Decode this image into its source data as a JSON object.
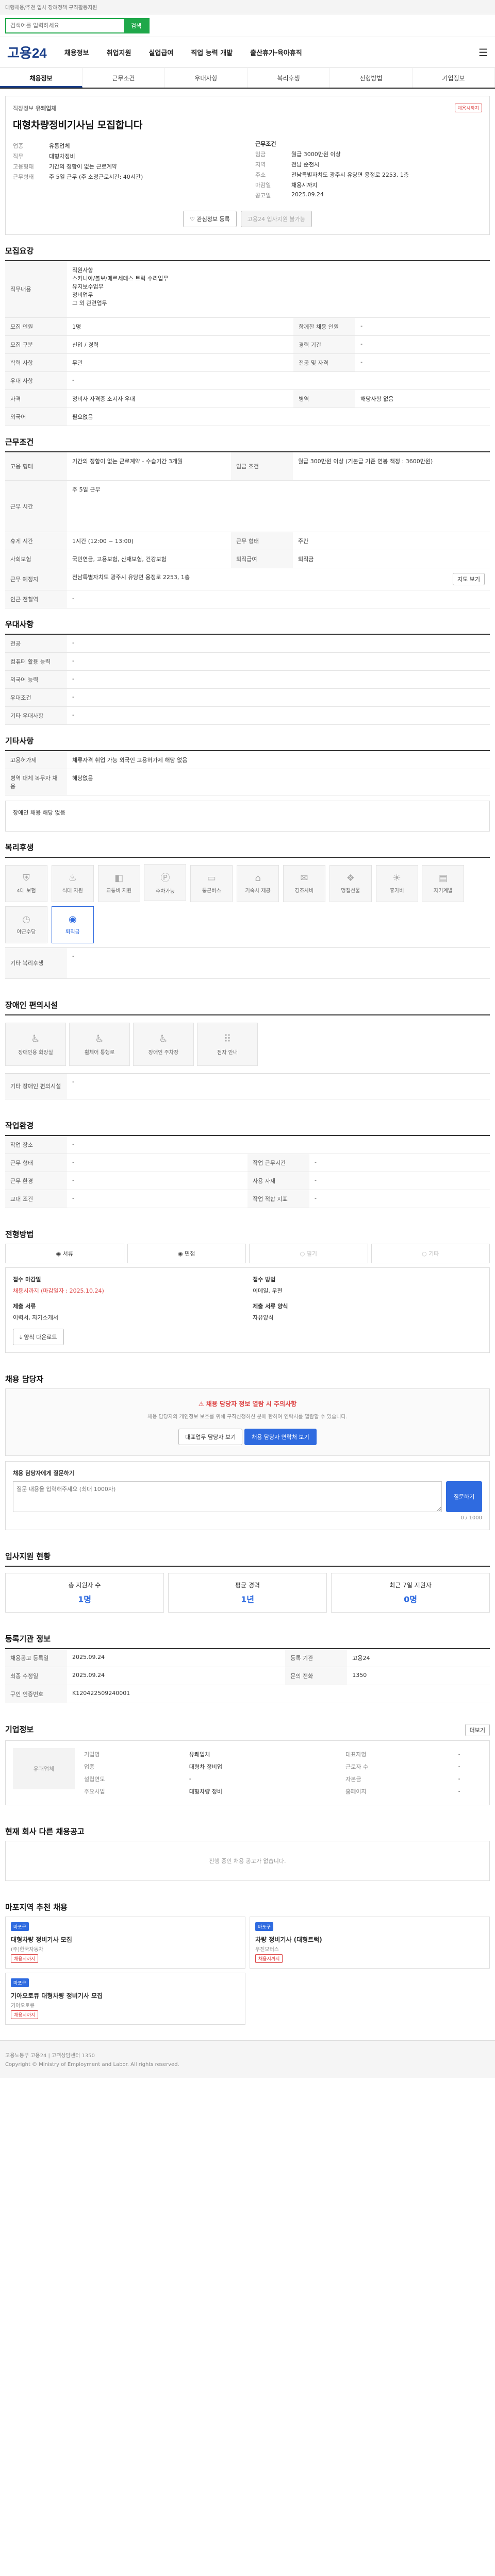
{
  "top_notice": "대행채용/추천 입사 장려정책 구직활동지원",
  "search": {
    "placeholder": "검색어를 입력하세요",
    "button": "검색"
  },
  "gnb": {
    "logo": "고용24",
    "menus": [
      "채용정보",
      "취업지원",
      "실업급여",
      "직업 능력 개발",
      "출산휴가·육아휴직"
    ]
  },
  "tabs": [
    "채용정보",
    "근무조건",
    "우대사항",
    "복리후생",
    "전형방법",
    "기업정보"
  ],
  "job": {
    "company_label": "직장정보",
    "company": "유쾌업체",
    "badge": "채용시까지",
    "title": "대형차량정비기사님 모집합니다",
    "left_rows": [
      [
        "업종",
        "유통업체"
      ],
      [
        "직무",
        "대형차정비"
      ],
      [
        "고용형태",
        "기간의 정함이 없는 근로계약"
      ],
      [
        "근무형태",
        "주 5일 근무 (주 소정근로시간: 40시간)"
      ]
    ],
    "right_label": "근무조건",
    "right_rows": [
      [
        "임금",
        "월급 3000만원 이상"
      ],
      [
        "지역",
        "전남 순천시"
      ],
      [
        "주소",
        "전남특별자치도 광주시 유당면 용정로 2253, 1층"
      ],
      [
        "마감일",
        "채용시까지"
      ],
      [
        "공고일",
        "2025.09.24"
      ]
    ],
    "save_label": "관심정보 등록",
    "apply_label": "고용24 입사지원 불가능"
  },
  "recruit": {
    "title": "모집요강",
    "duty_label": "직무내용",
    "duty": "직원사항\n스카니아/볼보/메르세데스 트럭 수리업무\n유지보수업무\n정비업무\n그 외 관련업무",
    "rows": [
      [
        "모집 인원",
        "1명",
        "함께한 채용 인원",
        "-"
      ],
      [
        "모집 구분",
        "신입 / 경력",
        "경력 기간",
        "-"
      ],
      [
        "학력 사항",
        "무관",
        "전공 및 자격",
        "-"
      ],
      [
        "우대 사항",
        "-",
        "",
        ""
      ],
      [
        "자격",
        "정비사 자격증 소지자 우대",
        "병역",
        "해당사항 없음"
      ],
      [
        "외국어",
        "필요없음",
        "",
        ""
      ]
    ]
  },
  "cond": {
    "title": "근무조건",
    "rows": [
      [
        "고용 형태",
        "기간의 정함이 없는 근로계약 - 수습기간 3개월",
        "임금 조건",
        "월급 300만원 이상 (기본급 기준 연봉 책정 : 3600만원)"
      ],
      [
        "근무 시간",
        "주 5일 근무",
        "",
        ""
      ],
      [
        "휴게 시간",
        "1시간 (12:00 ~ 13:00)",
        "근무 형태",
        "주간"
      ],
      [
        "사회보험",
        "국민연금, 고용보험, 산재보험, 건강보험",
        "퇴직급여",
        "퇴직금"
      ],
      [
        "근무 예정지",
        "전남특별자치도 광주시 유당면 용정로 2253, 1층",
        "",
        ""
      ],
      [
        "인근 전철역",
        "-",
        "",
        ""
      ]
    ],
    "map_button": "지도 보기"
  },
  "pref": {
    "title": "우대사항",
    "rows": [
      [
        "전공",
        "-"
      ],
      [
        "컴퓨터 활용 능력",
        "-"
      ],
      [
        "외국어 능력",
        "-"
      ],
      [
        "우대조건",
        "-"
      ],
      [
        "기타 우대사항",
        "-"
      ]
    ]
  },
  "other": {
    "title": "기타사항",
    "rows": [
      [
        "고용허가제",
        "체류자격 취업 가능 외국인 고용허가제 해당 없음"
      ],
      [
        "병역 대체 복무자 채용",
        "해당없음"
      ]
    ],
    "disabled": "장애인 채용 해당 없음"
  },
  "welfare": {
    "title": "복리후생",
    "items": [
      "4대 보험",
      "식대 지원",
      "교통비 지원",
      "주차가능",
      "통근버스",
      "기숙사 제공",
      "경조사비",
      "명절선물",
      "휴가비",
      "자기계발",
      "야근수당",
      "퇴직금"
    ],
    "etc_label": "기타 복리후생",
    "etc": "-"
  },
  "disabled_facility": {
    "title": "장애인 편의시설",
    "items": [
      "장애인용 화장실",
      "휠체어 통행로",
      "장애인 주차장",
      "점자 안내"
    ],
    "etc_label": "기타 장애인 편의시설",
    "etc": "-"
  },
  "work_env": {
    "title": "작업환경",
    "rows": [
      [
        "작업 장소",
        "-",
        "",
        ""
      ],
      [
        "근무 형태",
        "-",
        "작업 근무시간",
        "-"
      ],
      [
        "근무 환경",
        "-",
        "사용 자재",
        "-"
      ],
      [
        "교대 조건",
        "-",
        "작업 적합 지표",
        "-"
      ]
    ]
  },
  "method": {
    "title": "전형방법",
    "steps": [
      "서류",
      "면접",
      "필기",
      "기타"
    ],
    "submit_label": "접수 마감일",
    "submit_value": "채용시까지 (마감일자 : 2025.10.24)",
    "doc_label": "제출 서류",
    "doc_value": "이력서, 자기소개서",
    "apply_method_label": "접수 방법",
    "apply_method": "이메일, 우편",
    "form_label": "제출 서류 양식",
    "form_value": "자유양식",
    "form_button": "양식 다운로드"
  },
  "manager": {
    "title": "채용 담당자",
    "alert": "채용 담당자 정보 열람 시 주의사항",
    "desc": "채용 담당자의 개인정보 보호를 위해 구직신청하신 분에 한하여 연락처를 열람할 수 있습니다.",
    "btn1": "대표업무 담당자 보기",
    "btn2": "채용 담당자 연락처 보기",
    "question_label": "채용 담당자에게 질문하기",
    "question_placeholder": "질문 내용을 입력해주세요 (최대 1000자)",
    "question_btn": "질문하기",
    "count": "0 / 1000"
  },
  "stats": {
    "title": "입사지원 현황",
    "items": [
      [
        "총 지원자 수",
        "1명"
      ],
      [
        "평균 경력",
        "1년"
      ],
      [
        "최근 7일 지원자",
        "0명"
      ]
    ]
  },
  "posting": {
    "title": "등록기관 정보",
    "rows": [
      [
        "채용공고 등록일",
        "2025.09.24",
        "등록 기관",
        "고용24"
      ],
      [
        "최종 수정일",
        "2025.09.24",
        "문의 전화",
        "1350"
      ],
      [
        "구인 인증번호",
        "K120422509240001",
        "",
        ""
      ]
    ]
  },
  "company": {
    "title": "기업정보",
    "name": "유쾌업체",
    "rows": [
      [
        "기업명",
        "유쾌업체",
        "대표자명",
        "-"
      ],
      [
        "업종",
        "대형차 정비업",
        "근로자 수",
        "-"
      ],
      [
        "설립연도",
        "-",
        "자본금",
        "-"
      ],
      [
        "주요사업",
        "대형차량 정비",
        "홈페이지",
        "-"
      ]
    ],
    "more_btn": "더보기"
  },
  "similar": {
    "title": "현재 회사 다른 채용공고",
    "empty": "진행 중인 채용 공고가 없습니다."
  },
  "recommend": {
    "title": "마포지역 추천 채용",
    "items": [
      {
        "badge": "마포구",
        "title": "대형차량 정비기사 모집",
        "company": "(주)한국자동차",
        "tag": "채용시까지"
      },
      {
        "badge": "마포구",
        "title": "차량 정비기사 (대형트럭)",
        "company": "우진모터스",
        "tag": "채용시까지"
      },
      {
        "badge": "마포구",
        "title": "기아오토큐 대형차량 정비기사 모집",
        "company": "기아오토큐",
        "tag": "채용시까지"
      }
    ]
  },
  "footer": {
    "line1": "고용노동부 고용24 | 고객상담센터 1350",
    "line2": "Copyright © Ministry of Employment and Labor. All rights reserved."
  }
}
